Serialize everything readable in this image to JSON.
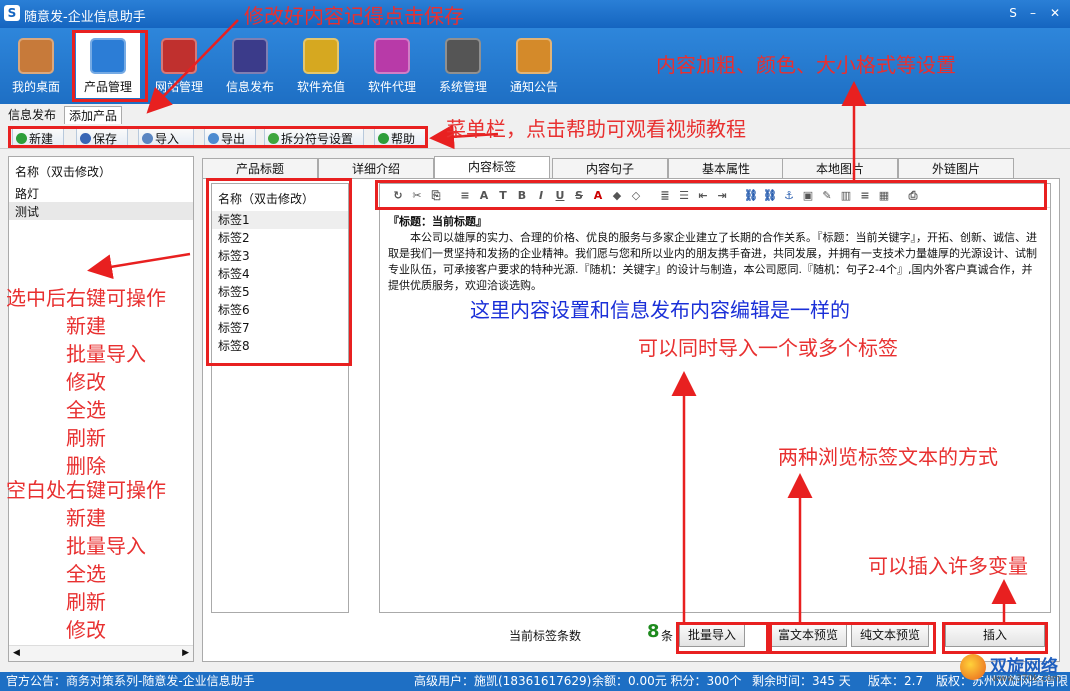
{
  "window": {
    "title": "随意发-企业信息助手",
    "min": "–",
    "max": "□",
    "close": "✕",
    "skin": "S"
  },
  "toolbar": [
    {
      "label": "我的桌面",
      "icon": "house-icon",
      "color": "#c77a3a"
    },
    {
      "label": "产品管理",
      "icon": "cloud-icon",
      "color": "#2c7dd6"
    },
    {
      "label": "网站管理",
      "icon": "website-icon",
      "color": "#c0302e"
    },
    {
      "label": "信息发布",
      "icon": "magic-wand-icon",
      "color": "#3b3b8a"
    },
    {
      "label": "软件充值",
      "icon": "coins-icon",
      "color": "#d6a820"
    },
    {
      "label": "软件代理",
      "icon": "gift-icon",
      "color": "#b83aa8"
    },
    {
      "label": "系统管理",
      "icon": "gear-icon",
      "color": "#555555"
    },
    {
      "label": "通知公告",
      "icon": "notebook-icon",
      "color": "#d48a2a"
    }
  ],
  "subtabs": [
    "信息发布",
    "添加产品"
  ],
  "menubar": [
    {
      "label": "新建",
      "icon": "plus-icon",
      "color": "#2e9e3a"
    },
    {
      "label": "保存",
      "icon": "save-icon",
      "color": "#3866b5"
    },
    {
      "label": "导入",
      "icon": "folder-icon",
      "color": "#5b86c2"
    },
    {
      "label": "导出",
      "icon": "export-icon",
      "color": "#4d8bd0"
    },
    {
      "label": "拆分符号设置",
      "icon": "arrow-up-icon",
      "color": "#3ea63e"
    },
    {
      "label": "帮助",
      "icon": "help-icon",
      "color": "#2e9e3a"
    }
  ],
  "leftlist": {
    "header": "名称（双击修改）",
    "items": [
      "路灯",
      "测试"
    ]
  },
  "tabs": [
    "产品标题",
    "详细介绍",
    "内容标签",
    "内容句子",
    "基本属性",
    "本地图片",
    "外链图片"
  ],
  "taglist": {
    "header": "名称（双击修改）",
    "items": [
      "标签1",
      "标签2",
      "标签3",
      "标签4",
      "标签5",
      "标签6",
      "标签7",
      "标签8"
    ]
  },
  "editor": {
    "title": "『标题：当前标题』",
    "body": "本公司以雄厚的实力、合理的价格、优良的服务与多家企业建立了长期的合作关系。『标题：当前关键字』，开拓、创新、诚信、进取是我们一贯坚持和发扬的企业精神。我们愿与您和所以业内的朋友携手奋进，共同发展，并拥有一支技术力量雄厚的光源设计、试制专业队伍，可承接客户要求的特种光源.『随机：关键字』的设计与制造，本公司愿同.『随机：句子2-4个』,国内外客户真诚合作，并提供优质服务，欢迎洽谈选购。"
  },
  "bottom": {
    "count_label": "当前标签条数",
    "count": "8",
    "unit": "条",
    "import_btn": "批量导入",
    "rich_preview": "富文本预览",
    "plain_preview": "纯文本预览",
    "insert_btn": "插入"
  },
  "status": {
    "notice": "官方公告：商务对策系列-随意发-企业信息助手",
    "user": "高级用户：施凯(18361617629)",
    "balance": "余额：0.00元 积分：300个",
    "remaining": "剩余时间：345 天",
    "version": "版本：2.7",
    "copyright": "版权：苏州双旋网络有限"
  },
  "annotations": {
    "save": "修改好内容记得点击保存",
    "format": "内容加粗、颜色、大小格式等设置",
    "menu": "菜单栏，点击帮助可观看视频教程",
    "select": "选中后右键可操作",
    "select_items": [
      "新建",
      "批量导入",
      "修改",
      "全选",
      "刷新",
      "删除"
    ],
    "blank": "空白处右键可操作",
    "blank_items": [
      "新建",
      "批量导入",
      "全选",
      "刷新",
      "修改"
    ],
    "same": "这里内容设置和信息发布内容编辑是一样的",
    "import": "可以同时导入一个或多个标签",
    "browse": "两种浏览标签文本的方式",
    "insert": "可以插入许多变量"
  },
  "watermark": {
    "text": "双旋网络",
    "url": "www.370k.com"
  }
}
